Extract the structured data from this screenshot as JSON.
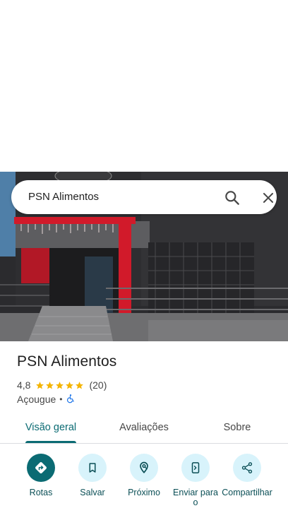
{
  "search": {
    "query": "PSN Alimentos"
  },
  "place": {
    "name": "PSN Alimentos",
    "rating": "4,8",
    "stars": 5,
    "reviews": "(20)",
    "category": "Açougue",
    "separator": "•"
  },
  "tabs": [
    {
      "label": "Visão geral",
      "active": true
    },
    {
      "label": "Avaliações",
      "active": false
    },
    {
      "label": "Sobre",
      "active": false
    }
  ],
  "actions": [
    {
      "label": "Rotas",
      "icon": "directions-icon"
    },
    {
      "label": "Salvar",
      "icon": "bookmark-icon"
    },
    {
      "label": "Próximo",
      "icon": "nearby-icon"
    },
    {
      "label": "Enviar para o",
      "icon": "send-to-phone-icon"
    },
    {
      "label": "Compartilhar",
      "icon": "share-icon"
    }
  ],
  "colors": {
    "accent": "#0b6b73",
    "action_bg": "#d8f3fb",
    "star": "#f4b400",
    "storefront_red": "#d11a2a"
  }
}
